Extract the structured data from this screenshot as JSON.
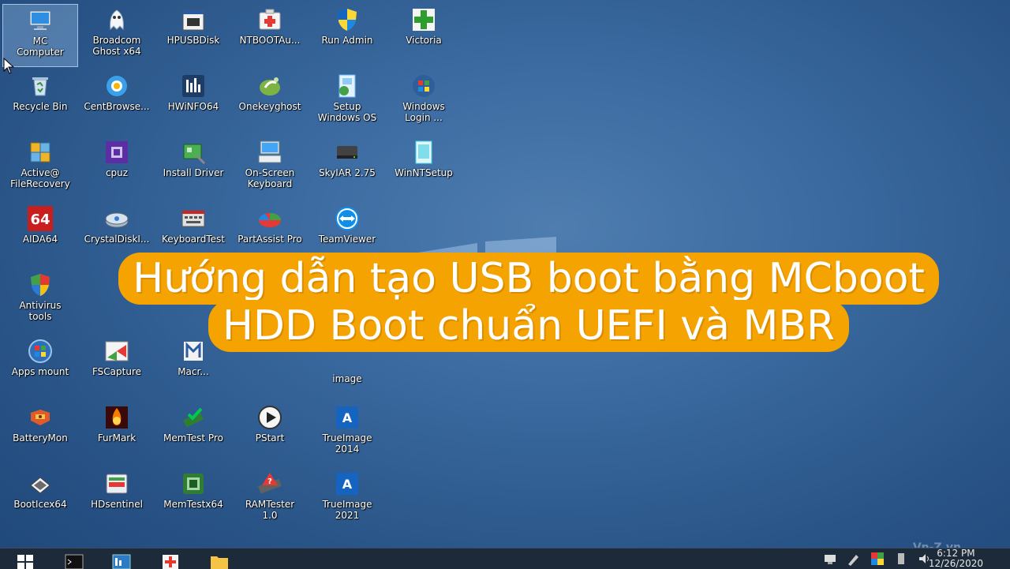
{
  "desktop": {
    "icons": [
      {
        "label": "MC\nComputer",
        "icon": "computer-icon"
      },
      {
        "label": "Broadcom\nGhost x64",
        "icon": "ghost-icon"
      },
      {
        "label": "HPUSBDisk",
        "icon": "usb-tool-icon"
      },
      {
        "label": "NTBOOTAu...",
        "icon": "first-aid-icon"
      },
      {
        "label": "Run Admin",
        "icon": "shield-icon"
      },
      {
        "label": "Victoria",
        "icon": "green-cross-icon"
      },
      {
        "label": "Recycle Bin",
        "icon": "recycle-bin-icon"
      },
      {
        "label": "CentBrowse...",
        "icon": "browser-icon"
      },
      {
        "label": "HWiNFO64",
        "icon": "hwinfo-icon"
      },
      {
        "label": "Onekeyghost",
        "icon": "onekeyghost-icon"
      },
      {
        "label": "Setup\nWindows OS",
        "icon": "setup-icon"
      },
      {
        "label": "Windows\nLogin ...",
        "icon": "windows-flag-icon"
      },
      {
        "label": "Active@\nFileRecovery",
        "icon": "file-recovery-icon"
      },
      {
        "label": "cpuz",
        "icon": "cpu-icon"
      },
      {
        "label": "Install Driver",
        "icon": "driver-icon"
      },
      {
        "label": "On-Screen\nKeyboard",
        "icon": "keyboard-icon"
      },
      {
        "label": "SkyIAR 2.75",
        "icon": "drive-icon"
      },
      {
        "label": "WinNTSetup",
        "icon": "winnt-icon"
      },
      {
        "label": "AIDA64",
        "icon": "aida64-icon"
      },
      {
        "label": "CrystalDiskI...",
        "icon": "disk-info-icon"
      },
      {
        "label": "KeyboardTest",
        "icon": "keyboard-test-icon"
      },
      {
        "label": "PartAssist Pro",
        "icon": "partition-icon"
      },
      {
        "label": "TeamViewer",
        "icon": "teamviewer-icon"
      },
      {
        "label": "Antivirus\ntools",
        "icon": "antivirus-shield-icon"
      },
      {
        "label": "Apps mount",
        "icon": "windows-orb-icon"
      },
      {
        "label": "FSCapture",
        "icon": "fscapture-icon"
      },
      {
        "label": "Macr...",
        "icon": "macrium-icon"
      },
      {
        "label": "image",
        "icon": "blank-icon"
      },
      {
        "label": "BatteryMon",
        "icon": "battery-icon"
      },
      {
        "label": "FurMark",
        "icon": "furmark-icon"
      },
      {
        "label": "MemTest Pro",
        "icon": "memtest-icon"
      },
      {
        "label": "PStart",
        "icon": "play-icon"
      },
      {
        "label": "TrueImage\n2014",
        "icon": "trueimage-icon"
      },
      {
        "label": "BootIcex64",
        "icon": "bootice-icon"
      },
      {
        "label": "HDsentinel",
        "icon": "hdsentinel-icon"
      },
      {
        "label": "MemTestx64",
        "icon": "memtestx64-icon"
      },
      {
        "label": "RAMTester\n1.0",
        "icon": "ramtester-icon"
      },
      {
        "label": "TrueImage\n2021",
        "icon": "trueimage-icon"
      }
    ]
  },
  "banner": {
    "line1": "Hướng dẫn tạo USB boot bằng MCboot",
    "line2": "HDD Boot chuẩn UEFI và MBR"
  },
  "taskbar": {
    "time": "6:12 PM",
    "date": "12/26/2020"
  },
  "watermark": "Vn-Z.vn",
  "colors": {
    "banner_bg": "#f5a300",
    "taskbar_bg": "#1c2a3a",
    "desktop_accent": "#3a6aa0"
  }
}
